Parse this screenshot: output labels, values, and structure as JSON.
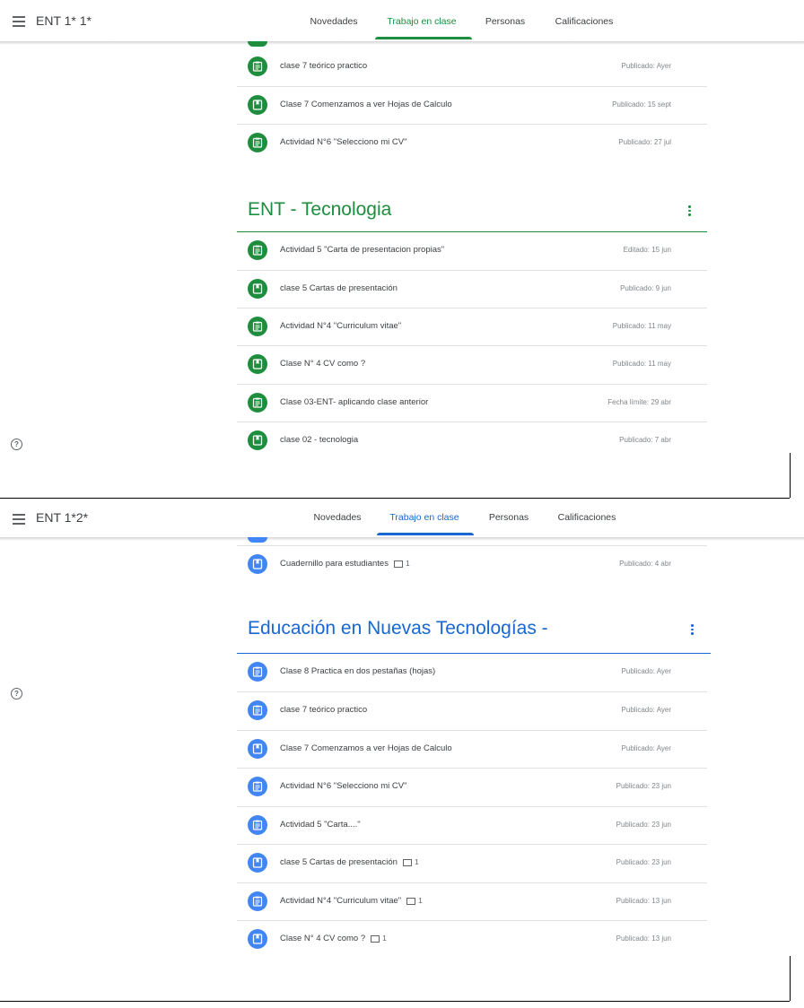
{
  "panel1": {
    "class_title": "ENT 1* 1*",
    "tabs": [
      "Novedades",
      "Trabajo en clase",
      "Personas",
      "Calificaciones"
    ],
    "accent": "#1e8e3e",
    "top_items": [
      {
        "icon": "assignment-icon",
        "title": "clase 7 teórico practico",
        "date": "Publicado: Ayer"
      },
      {
        "icon": "material-icon",
        "title": "Clase 7 Comenzamos a ver Hojas de Calculo",
        "date": "Publicado: 15 sept"
      },
      {
        "icon": "assignment-icon",
        "title": "Actividad N°6 \"Selecciono mi CV\"",
        "date": "Publicado: 27 jul"
      }
    ],
    "section_title": "ENT - Tecnologia",
    "section_items": [
      {
        "icon": "assignment-icon",
        "title": "Actividad 5 \"Carta de presentacion propias\"",
        "date": "Editado: 15 jun"
      },
      {
        "icon": "material-icon",
        "title": "clase 5 Cartas de presentación",
        "date": "Publicado: 9 jun"
      },
      {
        "icon": "assignment-icon",
        "title": "Actividad N°4 \"Curriculum vitae\"",
        "date": "Publicado: 11 may"
      },
      {
        "icon": "material-icon",
        "title": "Clase N° 4 CV como ?",
        "date": "Publicado: 11 may"
      },
      {
        "icon": "assignment-icon",
        "title": "Clase 03-ENT- aplicando clase anterior",
        "date": "Fecha límite: 29 abr"
      },
      {
        "icon": "material-icon",
        "title": "clase 02 - tecnologia",
        "date": "Publicado: 7 abr"
      }
    ]
  },
  "panel2": {
    "class_title": "ENT 1*2*",
    "tabs": [
      "Novedades",
      "Trabajo en clase",
      "Personas",
      "Calificaciones"
    ],
    "accent": "#1967d2",
    "top_items": [
      {
        "icon": "material-icon",
        "title": "Cuadernillo para estudiantes",
        "comments": "1",
        "date": "Publicado: 4 abr"
      }
    ],
    "section_title": "Educación en Nuevas Tecnologías -",
    "section_items": [
      {
        "icon": "assignment-icon",
        "title": "Clase 8 Practica en dos pestañas (hojas)",
        "date": "Publicado: Ayer"
      },
      {
        "icon": "assignment-icon",
        "title": "clase 7 teórico practico",
        "date": "Publicado: Ayer"
      },
      {
        "icon": "material-icon",
        "title": "Clase 7 Comenzamos a ver Hojas de Calculo",
        "date": "Publicado: Ayer"
      },
      {
        "icon": "assignment-icon",
        "title": "Actividad N°6 \"Selecciono mi CV\"",
        "date": "Publicado: 23 jun"
      },
      {
        "icon": "assignment-icon",
        "title": "Actividad 5 \"Carta....\"",
        "date": "Publicado: 23 jun"
      },
      {
        "icon": "material-icon",
        "title": "clase 5 Cartas de presentación",
        "comments": "1",
        "date": "Publicado: 23 jun"
      },
      {
        "icon": "assignment-icon",
        "title": "Actividad N°4 \"Curriculum vitae\"",
        "comments": "1",
        "date": "Publicado: 13 jun"
      },
      {
        "icon": "material-icon",
        "title": "Clase N° 4 CV como ?",
        "comments": "1",
        "date": "Publicado: 13 jun"
      }
    ]
  }
}
